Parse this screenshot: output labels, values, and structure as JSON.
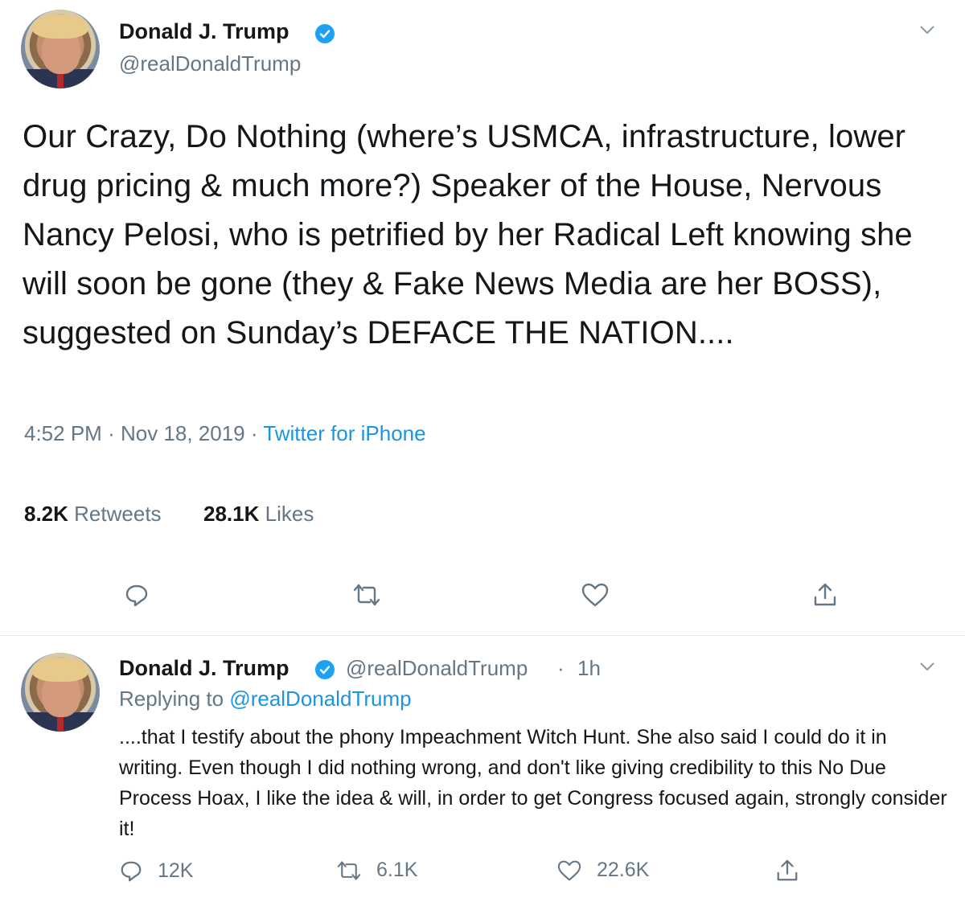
{
  "tweet1": {
    "author_name": "Donald J. Trump",
    "author_handle": "@realDonaldTrump",
    "text": "Our Crazy, Do Nothing (where’s USMCA, infrastructure, lower drug pricing & much more?) Speaker of the House, Nervous Nancy Pelosi, who is petrified by her Radical Left knowing she will soon be gone (they & Fake News Media are her BOSS), suggested on Sunday’s DEFACE THE NATION....",
    "time": "4:52 PM",
    "date": "Nov 18, 2019",
    "source": "Twitter for iPhone",
    "retweets_count": "8.2K",
    "retweets_label": "Retweets",
    "likes_count": "28.1K",
    "likes_label": "Likes"
  },
  "tweet2": {
    "author_name": "Donald J. Trump",
    "author_handle": "@realDonaldTrump",
    "age": "1h",
    "replying_to_label": "Replying to",
    "replying_to_handle": "@realDonaldTrump",
    "text": "....that I testify about the phony Impeachment Witch Hunt. She also said I could do it in writing. Even though I did nothing wrong, and don't like giving credibility to this No Due Process Hoax, I like the idea & will, in order to get Congress focused again, strongly consider it!",
    "reply_count": "12K",
    "retweet_count": "6.1K",
    "like_count": "22.6K"
  },
  "icons": {
    "verified": "verified-badge-icon",
    "caret": "chevron-down-icon",
    "reply": "reply-icon",
    "retweet": "retweet-icon",
    "like": "heart-icon",
    "share": "share-icon"
  },
  "colors": {
    "link": "#1b95e0",
    "muted": "#657786",
    "verified": "#1da1f2",
    "divider": "#e6ecf0"
  }
}
